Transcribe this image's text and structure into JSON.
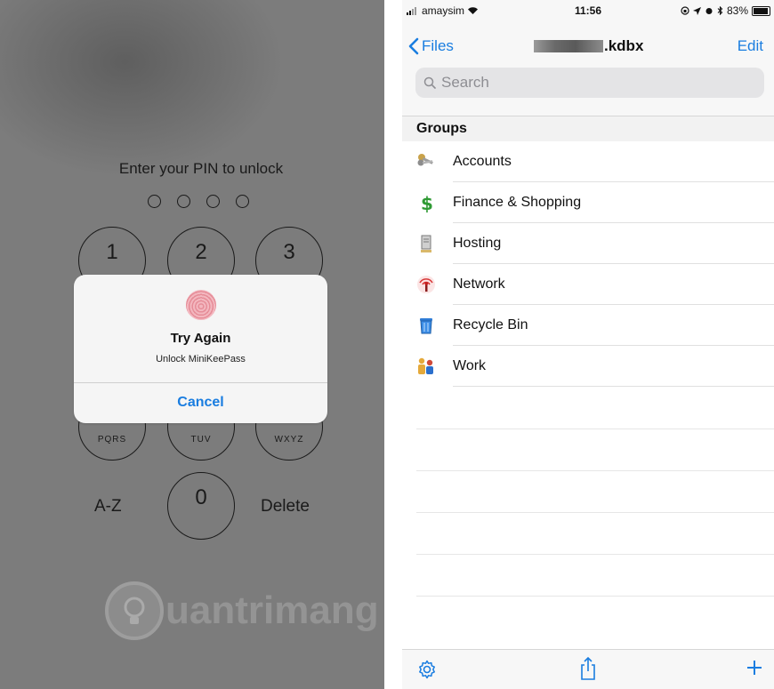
{
  "left": {
    "prompt": "Enter your PIN to unlock",
    "keys": [
      {
        "num": "1",
        "sub": ""
      },
      {
        "num": "2",
        "sub": ""
      },
      {
        "num": "3",
        "sub": ""
      },
      {
        "num": "",
        "sub": "PQRS"
      },
      {
        "num": "",
        "sub": "TUV"
      },
      {
        "num": "",
        "sub": "WXYZ"
      },
      {
        "num": "0",
        "sub": ""
      }
    ],
    "az_label": "A-Z",
    "delete_label": "Delete",
    "dialog": {
      "title": "Try Again",
      "subtitle": "Unlock MiniKeePass",
      "cancel": "Cancel"
    },
    "watermark": "uantrimang"
  },
  "right": {
    "status": {
      "carrier": "amaysim",
      "time": "11:56",
      "battery": "83%"
    },
    "nav": {
      "back_label": "Files",
      "title_suffix": ".kdbx",
      "edit_label": "Edit"
    },
    "search_placeholder": "Search",
    "section_title": "Groups",
    "groups": [
      {
        "label": "Accounts",
        "icon": "keys-icon"
      },
      {
        "label": "Finance & Shopping",
        "icon": "dollar-icon"
      },
      {
        "label": "Hosting",
        "icon": "server-icon"
      },
      {
        "label": "Network",
        "icon": "antenna-icon"
      },
      {
        "label": "Recycle Bin",
        "icon": "trash-icon"
      },
      {
        "label": "Work",
        "icon": "people-icon"
      }
    ],
    "toolbar_icons": [
      "gear-icon",
      "share-icon",
      "plus-icon"
    ],
    "accent_color": "#1a7de0"
  }
}
